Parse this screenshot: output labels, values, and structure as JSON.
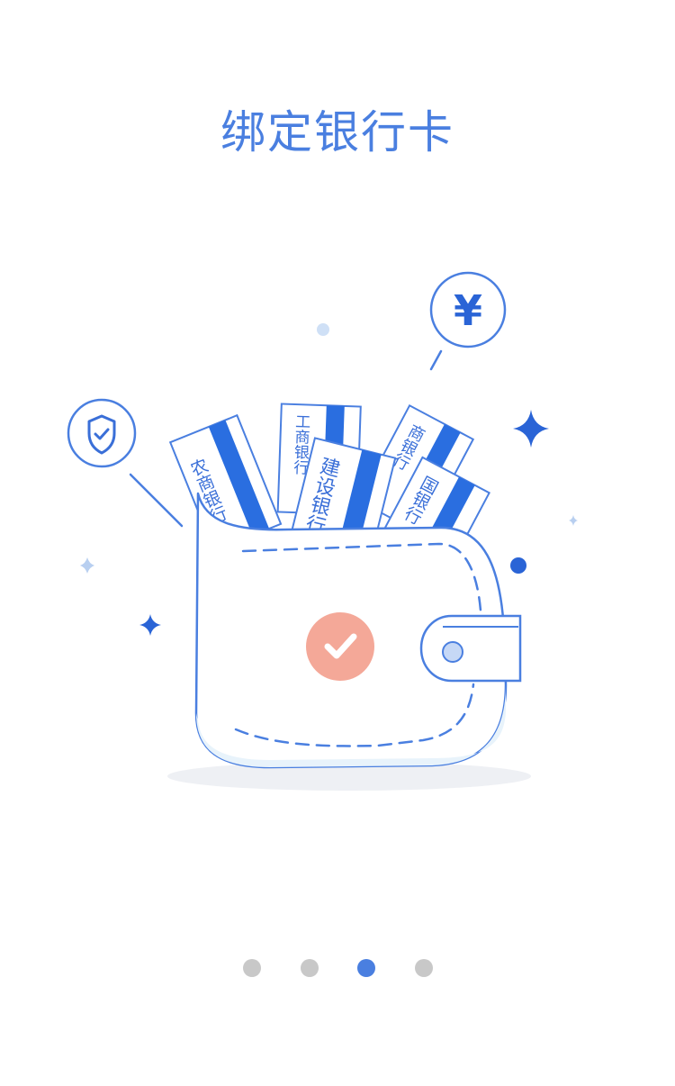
{
  "page": {
    "title": "绑定银行卡"
  },
  "illustration": {
    "currency_symbol": "¥",
    "cards": [
      {
        "label": "农商银行"
      },
      {
        "label": "工商银行"
      },
      {
        "label": "建设银行"
      },
      {
        "label": "商银行"
      },
      {
        "label": "国银行"
      }
    ],
    "icons": [
      "shield-check-icon",
      "yen-coin-icon",
      "sparkle-icon",
      "check-icon"
    ]
  },
  "pager": {
    "total": 4,
    "active_index": 2,
    "active_color": "#4a7fe0",
    "inactive_color": "#c8c8c8"
  },
  "colors": {
    "accent": "#4a7fe0",
    "card_stripe": "#2a6ee0",
    "check_badge": "#f4a898"
  }
}
